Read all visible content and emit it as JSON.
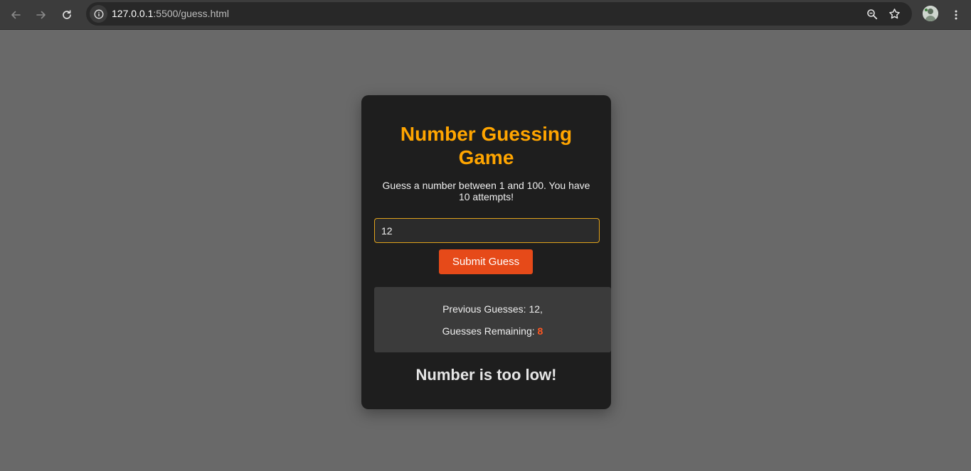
{
  "browser": {
    "url_host": "127.0.0.1",
    "url_rest": ":5500/guess.html"
  },
  "game": {
    "title": "Number Guessing Game",
    "instructions": "Guess a number between 1 and 100. You have 10 attempts!",
    "input_value": "12",
    "submit_label": "Submit Guess",
    "previous_label": "Previous Guesses: ",
    "previous_values": "12,",
    "remaining_label": "Guesses Remaining: ",
    "remaining_count": "8",
    "result_message": "Number is too low!"
  },
  "colors": {
    "page_background": "#696969",
    "card_background": "#1e1e1e",
    "title": "#ffa500",
    "button": "#e64a19",
    "remaining": "#ff5722",
    "input_border": "#e0a21c"
  },
  "icons": {
    "back": "arrow-left-icon",
    "forward": "arrow-right-icon",
    "reload": "reload-icon",
    "site_info": "info-icon",
    "zoom": "zoom-icon",
    "bookmark": "star-icon",
    "menu": "kebab-menu-icon"
  }
}
